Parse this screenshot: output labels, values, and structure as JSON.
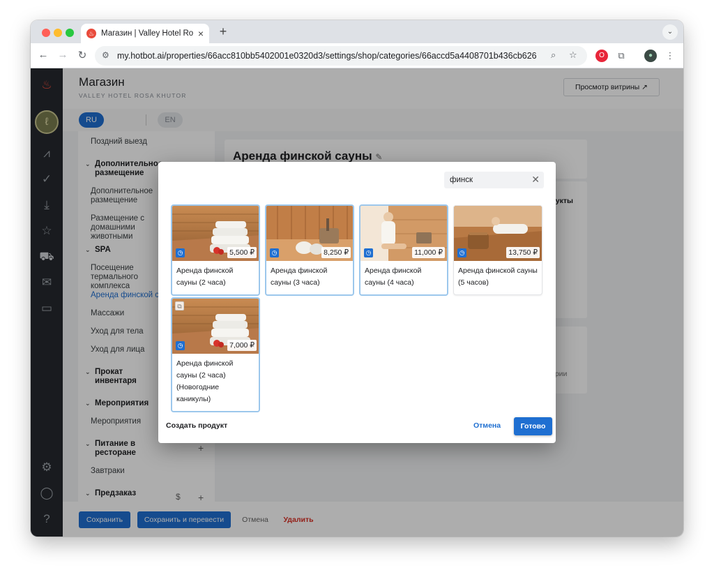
{
  "browser": {
    "tab_title": "Магазин | Valley Hotel Rosa Khutor",
    "new_tab": "+",
    "url": "my.hotbot.ai/properties/66acc810bb5402001e0320d3/settings/shop/categories/66accd5a4408701b436cb626"
  },
  "header": {
    "title": "Магазин",
    "subtitle": "VALLEY HOTEL ROSA KHUTOR",
    "preview_label": "Просмотр витрины ↗"
  },
  "langs": {
    "ru": "RU",
    "en": "EN"
  },
  "sidebar": {
    "items": [
      "Поздний выезд",
      "Дополнительное размещение",
      "Размещение с домашними животными",
      "Посещение термального комплекса",
      "Аренда финской сауны",
      "Массажи",
      "Уход для тела",
      "Уход для лица",
      "Мероприятия",
      "Завтраки"
    ],
    "groups": [
      "Дополнительное размещение",
      "SPA",
      "Прокат инвентаря",
      "Мероприятия",
      "Питание в ресторане",
      "Предзаказ"
    ]
  },
  "main": {
    "title": "Аренда финской сауны",
    "frag_products": "дукты",
    "frag_categories": "ории"
  },
  "footer": {
    "save": "Сохранить",
    "save_translate": "Сохранить и перевести",
    "cancel": "Отмена",
    "delete": "Удалить"
  },
  "modal": {
    "search_value": "финск",
    "products": [
      {
        "name": "Аренда финской сауны (2 часа)",
        "price": "5,500 ₽",
        "selected": true
      },
      {
        "name": "Аренда финской сауны (3 часа)",
        "price": "8,250 ₽",
        "selected": true
      },
      {
        "name": "Аренда финской сауны (4 часа)",
        "price": "11,000 ₽",
        "selected": true
      },
      {
        "name": "Аренда финской сауны (5 часов)",
        "price": "13,750 ₽",
        "selected": false
      },
      {
        "name": "Аренда финской сауны (2 часа) (Новогодние каникулы)",
        "price": "7,000 ₽",
        "selected": true
      }
    ],
    "create_label": "Создать продукт",
    "cancel_label": "Отмена",
    "done_label": "Готово"
  },
  "colors": {
    "accent": "#1f6fd1",
    "danger": "#d93025",
    "rail": "#25292f"
  }
}
